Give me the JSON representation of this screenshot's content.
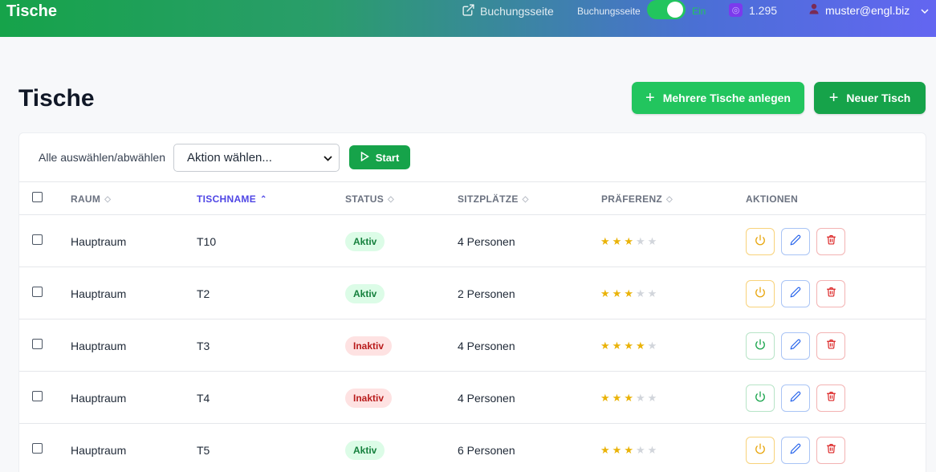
{
  "topbar": {
    "brand": "Tische",
    "booking_link": "Buchungsseite",
    "toggle_label": "Buchungsseite",
    "toggle_state": "Ein",
    "credits": "1.295",
    "user": "muster@engl.biz"
  },
  "header": {
    "title": "Tische",
    "multi_button": "Mehrere Tische anlegen",
    "new_button": "Neuer Tisch"
  },
  "bulk": {
    "select_all_label": "Alle auswählen/abwählen",
    "action_select": "Aktion wählen...",
    "start_button": "Start"
  },
  "table": {
    "columns": {
      "room": "RAUM",
      "name": "TISCHNAME",
      "status": "STATUS",
      "seats": "SITZPLÄTZE",
      "preference": "PRÄFERENZ",
      "actions": "AKTIONEN"
    },
    "rows": [
      {
        "room": "Hauptraum",
        "name": "T10",
        "status": "Aktiv",
        "seats": "4 Personen",
        "rating": 3
      },
      {
        "room": "Hauptraum",
        "name": "T2",
        "status": "Aktiv",
        "seats": "2 Personen",
        "rating": 3
      },
      {
        "room": "Hauptraum",
        "name": "T3",
        "status": "Inaktiv",
        "seats": "4 Personen",
        "rating": 4
      },
      {
        "room": "Hauptraum",
        "name": "T4",
        "status": "Inaktiv",
        "seats": "4 Personen",
        "rating": 3
      },
      {
        "room": "Hauptraum",
        "name": "T5",
        "status": "Aktiv",
        "seats": "6 Personen",
        "rating": 3
      }
    ],
    "max_rating": 5
  },
  "colors": {
    "green": "#16a34a",
    "active_sort": "#4f46e5",
    "star": "#eab308",
    "power_off": "#e8a50c",
    "power_on": "#16a34a",
    "edit": "#2563eb",
    "delete": "#dc2626"
  },
  "icons": {
    "booking_link": "external-link-icon",
    "credits": "credit-icon",
    "user": "user-icon",
    "dropdown": "chevron-down-icon",
    "start": "play-icon",
    "toggle_action": "power-icon",
    "edit": "pencil-icon",
    "delete": "trash-icon"
  }
}
